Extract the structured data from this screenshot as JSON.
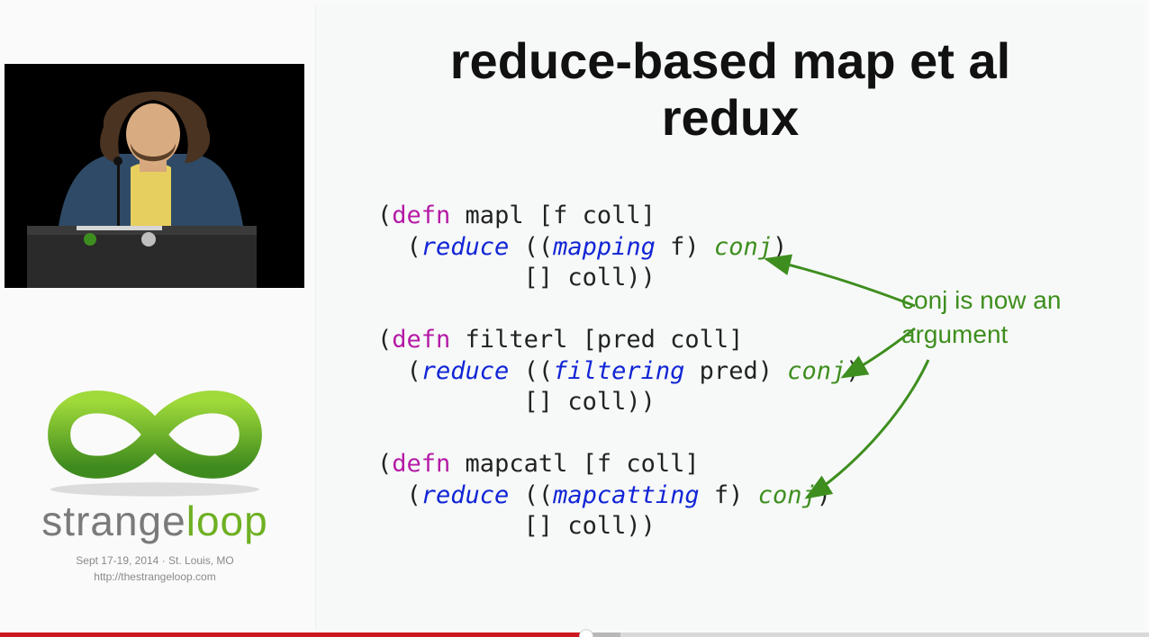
{
  "sidebar": {
    "conference_name_prefix": "strange",
    "conference_name_accent": "loop",
    "dates_location": "Sept 17-19, 2014   ·   St. Louis, MO",
    "url": "http://thestrangeloop.com"
  },
  "slide": {
    "title_line1": "reduce-based map et al",
    "title_line2": "redux",
    "annotation_line1": "conj is now an",
    "annotation_line2": "argument",
    "code": {
      "block1": {
        "l1": {
          "open": "(",
          "defn": "defn",
          "name": " mapl ",
          "args": "[f coll]"
        },
        "l2": {
          "indent": "  (",
          "reduce": "reduce",
          "mid": " ((",
          "xf": "mapping",
          "arg": " f) ",
          "conj": "conj",
          "close": ")"
        },
        "l3": "          [] coll))"
      },
      "block2": {
        "l1": {
          "open": "(",
          "defn": "defn",
          "name": " filterl ",
          "args": "[pred coll]"
        },
        "l2": {
          "indent": "  (",
          "reduce": "reduce",
          "mid": " ((",
          "xf": "filtering",
          "arg": " pred) ",
          "conj": "conj",
          "close": ")"
        },
        "l3": "          [] coll))"
      },
      "block3": {
        "l1": {
          "open": "(",
          "defn": "defn",
          "name": " mapcatl ",
          "args": "[f coll]"
        },
        "l2": {
          "indent": "  (",
          "reduce": "reduce",
          "mid": " ((",
          "xf": "mapcatting",
          "arg": " f) ",
          "conj": "conj",
          "close": ")"
        },
        "l3": "          [] coll))"
      }
    }
  },
  "playback": {
    "buffer_pct": 54,
    "played_pct": 51
  },
  "colors": {
    "defn": "#b51aa6",
    "reduce": "#1125d6",
    "conj": "#3e8e1f",
    "accent_green": "#6fb024",
    "youtube_red": "#cc181e"
  }
}
